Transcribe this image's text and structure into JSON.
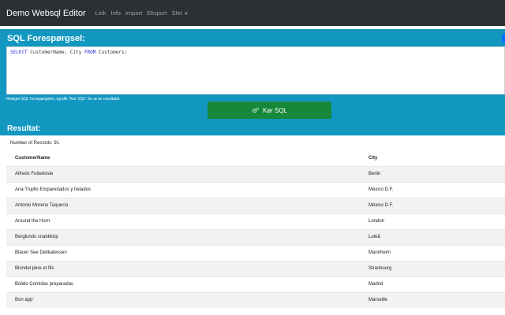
{
  "navbar": {
    "brand": "Demo Websql Editor",
    "links": [
      "Link",
      "Info",
      "Import",
      "Eksport"
    ],
    "dropdown": "Slet"
  },
  "sql": {
    "title": "SQL Forespørgsel:",
    "query_parts": {
      "kw_select": "SELECT",
      "columns": " CustomerName, City ",
      "kw_from": "FROM",
      "table": " Customers;"
    },
    "help_text": "Rediger SQL forespørgslen, og klik \"Kør SQL\" for at se resultatet.",
    "run_label": "Kør SQL"
  },
  "result": {
    "title": "Resultat:",
    "record_count": "Number of Records: 91",
    "headers": [
      "CustomerName",
      "City"
    ],
    "rows": [
      [
        "Alfreds Futterkiste",
        "Berlin"
      ],
      [
        "Ana Trujillo Emparedados y helados",
        "México D.F."
      ],
      [
        "Antonio Moreno Taquería",
        "México D.F."
      ],
      [
        "Around the Horn",
        "London"
      ],
      [
        "Berglunds snabbköp",
        "Luleå"
      ],
      [
        "Blauer See Delikatessen",
        "Mannheim"
      ],
      [
        "Blondel père et fils",
        "Strasbourg"
      ],
      [
        "Bólido Comidas preparadas",
        "Madrid"
      ],
      [
        "Bon app'",
        "Marseille"
      ]
    ]
  },
  "colors": {
    "navbar_bg": "#2b3035",
    "panel_bg": "#1297c1",
    "run_button_bg": "#16883a",
    "keyword": "#2a27d8"
  }
}
